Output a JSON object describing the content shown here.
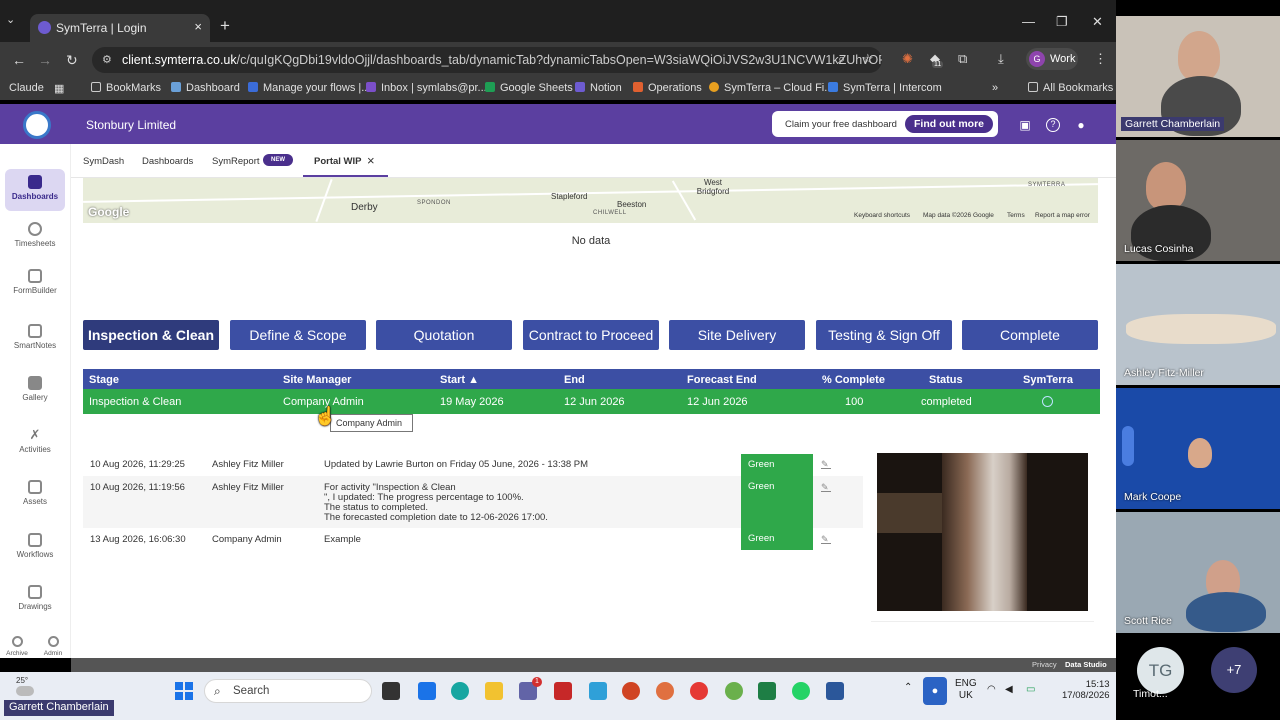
{
  "browser": {
    "tab_title": "SymTerra | Login",
    "url_domain": "client.symterra.co.uk",
    "url_path": "/c/quIgKQgDbi19vldoOjjl/dashboards_tab/dynamicTab?dynamicTabsOpen=W3siaWQiOiJVS2w3U1NCVW1kZUhvOFFYeUpQSi...",
    "profile_initial": "G",
    "profile_label": "Work",
    "extension_badge": "11",
    "bookmarks": [
      "Claude",
      "BookMarks",
      "Dashboard",
      "Manage your flows |...",
      "Inbox | symlabs@pr...",
      "Google Sheets",
      "Notion",
      "Operations",
      "SymTerra – Cloud Fi...",
      "SymTerra | Intercom",
      "All Bookmarks"
    ]
  },
  "app": {
    "company": "Stonbury Limited",
    "promo_text": "Claim your free dashboard",
    "promo_button": "Find out more"
  },
  "sidebar": {
    "items": [
      "Dashboards",
      "Timesheets",
      "FormBuilder",
      "SmartNotes",
      "Gallery",
      "Activities",
      "Assets",
      "Workflows",
      "Drawings"
    ],
    "bottom": [
      "Archive",
      "Admin"
    ]
  },
  "subtabs": {
    "items": [
      "SymDash",
      "Dashboards",
      "SymReport",
      "Portal WIP"
    ],
    "badge": "NEW",
    "close": "×"
  },
  "map": {
    "labels": [
      "Derby",
      "SPONDON",
      "Stapleford",
      "CHILWELL",
      "Beeston",
      "West Bridgford",
      "SYMTERRA"
    ],
    "google": "Google",
    "footer": [
      "Keyboard shortcuts",
      "Map data ©2026 Google",
      "Terms",
      "Report a map error"
    ]
  },
  "no_data": "No data",
  "stages": [
    "Inspection & Clean",
    "Define & Scope",
    "Quotation",
    "Contract to Proceed",
    "Site Delivery",
    "Testing & Sign Off",
    "Complete"
  ],
  "table": {
    "headers": [
      "Stage",
      "Site Manager",
      "Start ▲",
      "End",
      "Forecast End",
      "% Complete",
      "Status",
      "SymTerra"
    ],
    "row": [
      "Inspection & Clean",
      "Company Admin",
      "19 May 2026",
      "12 Jun 2026",
      "12 Jun 2026",
      "100",
      "completed"
    ],
    "tooltip": "Company Admin"
  },
  "log": [
    {
      "date": "10 Aug 2026, 11:29:25",
      "user": "Ashley Fitz Miller",
      "text": [
        "Updated by Lawrie Burton on Friday 05 June, 2026 - 13:38 PM"
      ],
      "status": "Green"
    },
    {
      "date": "10 Aug 2026, 11:19:56",
      "user": "Ashley Fitz Miller",
      "text": [
        "For activity \"Inspection & Clean",
        "\", I updated: The progress percentage to 100%.",
        "The status to completed.",
        "The forecasted completion date to 12-06-2026 17:00."
      ],
      "status": "Green"
    },
    {
      "date": "13 Aug 2026, 16:06:30",
      "user": "Company Admin",
      "text": [
        "Example"
      ],
      "status": "Green"
    }
  ],
  "bottom_bar": [
    "Privacy",
    "Data Studio"
  ],
  "taskbar": {
    "weather": "25°",
    "search": "Search",
    "teams_badge": "1",
    "lang": [
      "ENG",
      "UK"
    ],
    "time": "15:13",
    "date": "17/08/2026"
  },
  "participants": [
    "Garrett Chamberlain",
    "Lucas Cosinha",
    "Ashley Fitz-Miller",
    "Mark Coope",
    "Scott Rice"
  ],
  "tg_initials": "TG",
  "tg_name": "Timot...",
  "more_count": "+7",
  "presenter_badge": "Garrett Chamberlain"
}
